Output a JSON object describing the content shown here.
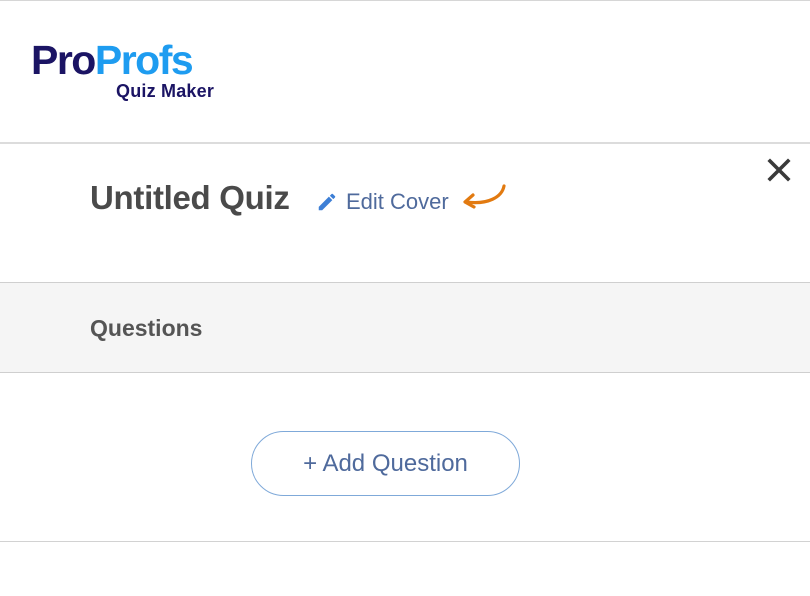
{
  "logo": {
    "pro": "Pro",
    "profs": "Profs",
    "subtitle": "Quiz Maker"
  },
  "header": {
    "title": "Untitled Quiz",
    "edit_cover_label": "Edit Cover",
    "close_icon": "close-icon",
    "edit_icon": "pencil-icon"
  },
  "questions_section": {
    "heading": "Questions",
    "add_button_label": "+ Add Question"
  },
  "colors": {
    "brand_dark": "#1b1464",
    "brand_light": "#1e9cf0",
    "link": "#4f6a9c",
    "accent_arrow": "#e27a10"
  }
}
